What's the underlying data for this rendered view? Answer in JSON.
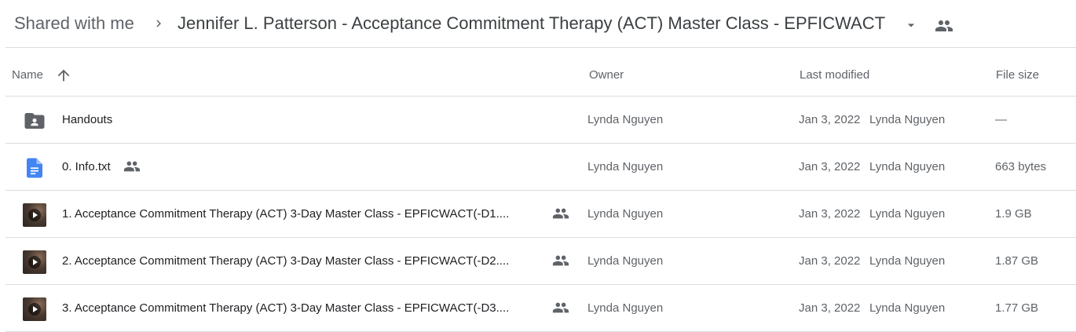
{
  "breadcrumb": {
    "root": "Shared with me",
    "current": "Jennifer L. Patterson - Acceptance Commitment Therapy (ACT) Master Class - EPFICWACT"
  },
  "columns": {
    "name": "Name",
    "owner": "Owner",
    "last_modified": "Last modified",
    "file_size": "File size"
  },
  "files": [
    {
      "name": "Handouts",
      "type": "shared-folder",
      "owner": "Lynda Nguyen",
      "date": "Jan 3, 2022",
      "modified_by": "Lynda Nguyen",
      "size": "—"
    },
    {
      "name": "0. Info.txt",
      "type": "document",
      "owner": "Lynda Nguyen",
      "date": "Jan 3, 2022",
      "modified_by": "Lynda Nguyen",
      "size": "663 bytes"
    },
    {
      "name": "1. Acceptance  Commitment Therapy (ACT) 3-Day Master Class - EPFICWACT(-D1....",
      "type": "video",
      "owner": "Lynda Nguyen",
      "date": "Jan 3, 2022",
      "modified_by": "Lynda Nguyen",
      "size": "1.9 GB"
    },
    {
      "name": "2. Acceptance  Commitment Therapy (ACT) 3-Day Master Class - EPFICWACT(-D2....",
      "type": "video",
      "owner": "Lynda Nguyen",
      "date": "Jan 3, 2022",
      "modified_by": "Lynda Nguyen",
      "size": "1.87 GB"
    },
    {
      "name": "3. Acceptance  Commitment Therapy (ACT) 3-Day Master Class - EPFICWACT(-D3....",
      "type": "video",
      "owner": "Lynda Nguyen",
      "date": "Jan 3, 2022",
      "modified_by": "Lynda Nguyen",
      "size": "1.77 GB"
    }
  ],
  "colors": {
    "doc_blue": "#4285f4",
    "folder_gray": "#5f6368",
    "divider": "#dadce0",
    "secondary_text": "#5f6368"
  },
  "icons": {
    "breadcrumb_separator": "chevron-right-icon",
    "dropdown": "arrow-drop-down-icon",
    "shared": "people-icon",
    "sort": "arrow-up-icon",
    "folder": "shared-folder-icon",
    "document": "google-docs-icon",
    "video": "video-thumbnail-icon"
  }
}
